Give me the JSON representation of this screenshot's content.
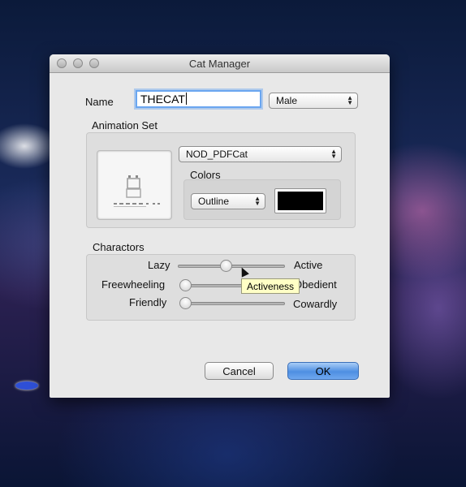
{
  "window": {
    "title": "Cat Manager"
  },
  "name_field": {
    "label": "Name",
    "value": "THECAT"
  },
  "gender_select": {
    "value": "Male"
  },
  "animation_set": {
    "label": "Animation Set",
    "selected": "NOD_PDFCat",
    "colors_label": "Colors",
    "color_mode": "Outline",
    "color_value": "#000000"
  },
  "characters": {
    "label": "Charactors",
    "sliders": [
      {
        "left": "Lazy",
        "right": "Active",
        "value": 0.45
      },
      {
        "left": "Freewheeling",
        "right": "Obedient",
        "value": 0.0
      },
      {
        "left": "Friendly",
        "right": "Cowardly",
        "value": 0.0
      }
    ],
    "tooltip": "Activeness"
  },
  "buttons": {
    "cancel": "Cancel",
    "ok": "OK"
  }
}
